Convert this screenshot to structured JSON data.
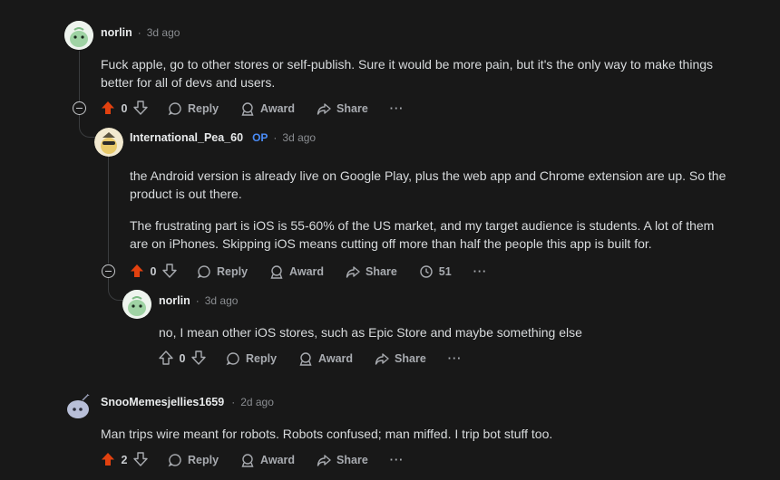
{
  "colors": {
    "background": "#181818",
    "upvote_active": "#e2410f",
    "op_badge": "#4a8cf7"
  },
  "comments": [
    {
      "username": "norlin",
      "dot": "·",
      "time": "3d ago",
      "body": [
        "Fuck apple, go to other stores or self-publish. Sure it would be more pain, but it's the only way to make things better for all of devs and users."
      ],
      "score": "0",
      "upvoted": true,
      "actions": {
        "reply": "Reply",
        "award": "Award",
        "share": "Share",
        "more": "···"
      }
    },
    {
      "username": "International_Pea_60",
      "op": "OP",
      "dot": "·",
      "time": "3d ago",
      "body": [
        "the Android version is already live on Google Play, plus the web app and Chrome extension are up. So the product is out there.",
        "The frustrating part is iOS is 55-60% of the US market, and my target audience is students. A lot of them are on iPhones. Skipping iOS means cutting off more than half the people this app is built for."
      ],
      "score": "0",
      "upvoted": true,
      "actions": {
        "reply": "Reply",
        "award": "Award",
        "share": "Share",
        "views": "51",
        "more": "···"
      }
    },
    {
      "username": "norlin",
      "dot": "·",
      "time": "3d ago",
      "body": [
        "no, I mean other iOS stores, such as Epic Store and maybe something else"
      ],
      "score": "0",
      "upvoted": false,
      "actions": {
        "reply": "Reply",
        "award": "Award",
        "share": "Share",
        "more": "···"
      }
    },
    {
      "username": "SnooMemesjellies1659",
      "dot": "·",
      "time": "2d ago",
      "body": [
        "Man trips wire meant for robots. Robots confused; man miffed. I trip bot stuff too."
      ],
      "score": "2",
      "upvoted": true,
      "actions": {
        "reply": "Reply",
        "award": "Award",
        "share": "Share",
        "more": "···"
      }
    }
  ]
}
